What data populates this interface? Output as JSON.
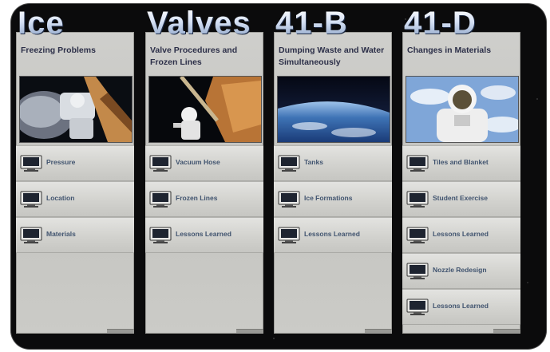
{
  "columns": [
    {
      "title": "Ice",
      "subtitle": "Freezing Problems",
      "photo_icon": "spacewalk-photo",
      "items": [
        "Pressure",
        "Location",
        "Materials"
      ]
    },
    {
      "title": "Valves",
      "subtitle": "Valve Procedures and Frozen Lines",
      "photo_icon": "astronaut-on-arm-photo",
      "items": [
        "Vacuum Hose",
        "Frozen Lines",
        "Lessons Learned"
      ]
    },
    {
      "title": "41-B",
      "subtitle": "Dumping Waste and Water Simultaneously",
      "photo_icon": "earth-horizon-photo",
      "items": [
        "Tanks",
        "Ice Formations",
        "Lessons Learned"
      ]
    },
    {
      "title": "41-D",
      "subtitle": "Changes in Materials",
      "photo_icon": "astronaut-closeup-photo",
      "items": [
        "Tiles and Blanket",
        "Student Exercise",
        "Lessons Learned",
        "Nozzle Redesign",
        "Lessons Learned"
      ]
    }
  ]
}
